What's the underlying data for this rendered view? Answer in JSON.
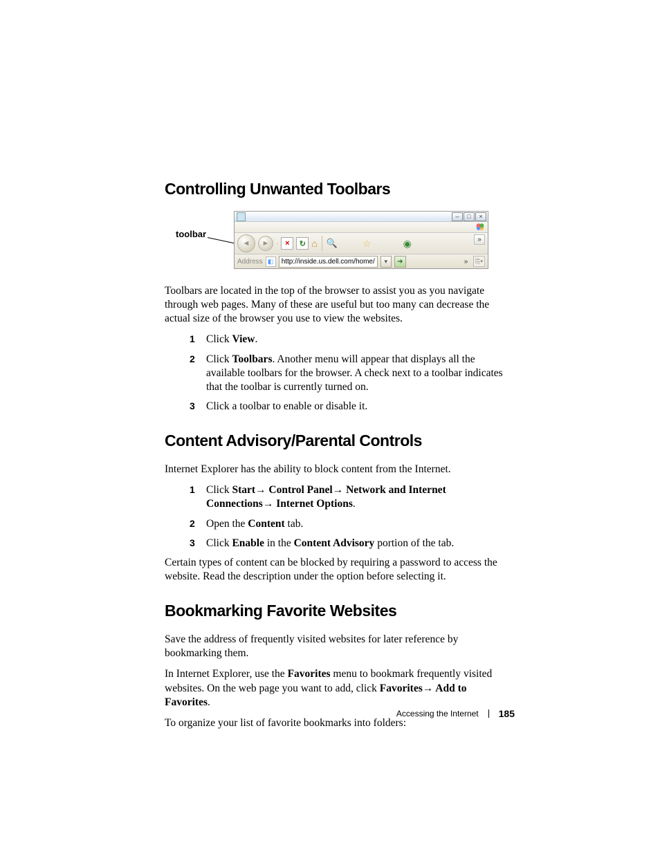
{
  "section1": {
    "title": "Controlling Unwanted Toolbars",
    "callout": "toolbar",
    "fig": {
      "address_label": "Address",
      "url": "http://inside.us.dell.com/home/",
      "win_min": "–",
      "win_max": "□",
      "win_close": "×"
    },
    "p1": "Toolbars are located in the top of the browser to assist you as you navigate through web pages. Many of these are useful but too many can decrease the actual size of the browser you use to view the websites.",
    "steps": {
      "s1a": "Click ",
      "s1b": "View",
      "s1c": ".",
      "s2a": "Click ",
      "s2b": "Toolbars",
      "s2c": ". Another menu will appear that displays all the available toolbars for the browser. A check next to a toolbar indicates that the toolbar is currently turned on.",
      "s3": "Click a toolbar to enable or disable it."
    }
  },
  "section2": {
    "title": "Content Advisory/Parental Controls",
    "p1": "Internet Explorer has the ability to block content from the Internet.",
    "steps": {
      "s1a": "Click ",
      "s1b": "Start→ Control Panel→ Network and Internet Connections→ Internet Options",
      "s1c": ".",
      "s2a": "Open the ",
      "s2b": "Content",
      "s2c": " tab.",
      "s3a": "Click ",
      "s3b": "Enable",
      "s3c": " in the ",
      "s3d": "Content Advisory",
      "s3e": " portion of the tab."
    },
    "p2": "Certain types of content can be blocked by requiring a password to access the website. Read the description under the option before selecting it."
  },
  "section3": {
    "title": "Bookmarking Favorite Websites",
    "p1": "Save the address of frequently visited websites for later reference by bookmarking them.",
    "p2a": "In Internet Explorer, use the ",
    "p2b": "Favorites",
    "p2c": " menu to bookmark frequently visited websites. On the web page you want to add, click ",
    "p2d": "Favorites→ Add to Favorites",
    "p2e": ".",
    "p3": "To organize your list of favorite bookmarks into folders:"
  },
  "footer": {
    "title": "Accessing the Internet",
    "page": "185"
  }
}
